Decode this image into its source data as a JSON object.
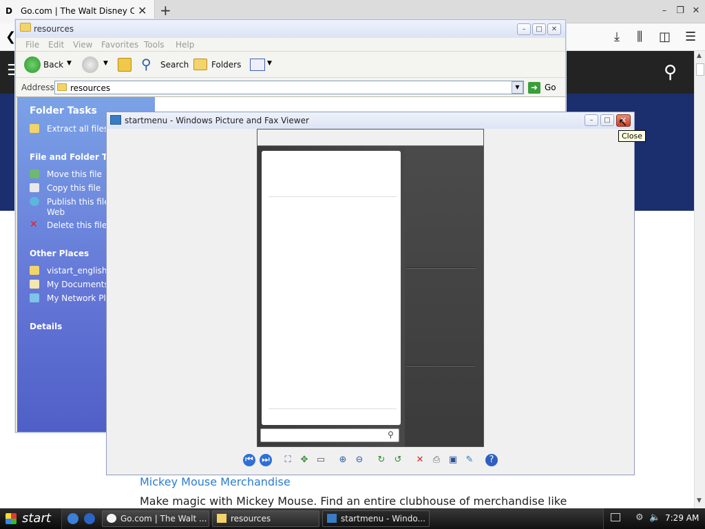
{
  "browser": {
    "tab_title": "Go.com | The Walt Disney Com",
    "new_tab": "+",
    "close_tab": "✕",
    "win_min": "–",
    "win_restore": "❐",
    "win_close": "✕"
  },
  "page": {
    "link": "Mickey Mouse Merchandise",
    "body": "Make magic with Mickey Mouse. Find an entire clubhouse of merchandise like"
  },
  "explorer": {
    "title": "resources",
    "menu": [
      "File",
      "Edit",
      "View",
      "Favorites",
      "Tools",
      "Help"
    ],
    "toolbar": {
      "back": "Back",
      "search": "Search",
      "folders": "Folders"
    },
    "address_label": "Address",
    "address_value": "resources",
    "go_label": "Go",
    "folder_tasks_title": "Folder Tasks",
    "extract_all": "Extract all files",
    "file_folder_tasks_title": "File and Folder Tasks",
    "move_file": "Move this file",
    "copy_file": "Copy this file",
    "publish_file_line1": "Publish this file t",
    "publish_file_line2": "Web",
    "delete_file": "Delete this file",
    "other_places_title": "Other Places",
    "place_1": "vistart_english_sk",
    "place_2": "My Documents",
    "place_3": "My Network Plac",
    "details_title": "Details"
  },
  "viewer": {
    "title": "startmenu - Windows Picture and Fax Viewer",
    "close_tooltip": "Close"
  },
  "taskbar": {
    "start": "start",
    "tasks": [
      "Go.com | The Walt ...",
      "resources",
      "startmenu - Windo..."
    ],
    "clock": "7:29 AM"
  }
}
